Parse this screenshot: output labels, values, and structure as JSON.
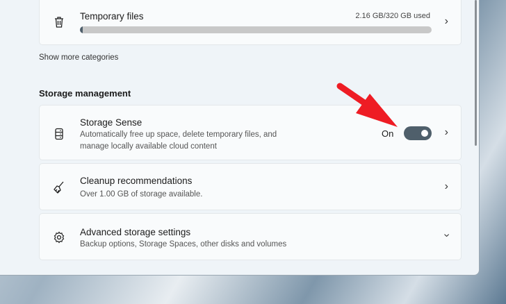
{
  "temp": {
    "title": "Temporary files",
    "usage": "2.16 GB/320 GB used",
    "used_fraction": 0.00675
  },
  "show_more": "Show more categories",
  "section": "Storage management",
  "sense": {
    "title": "Storage Sense",
    "desc1": "Automatically free up space, delete temporary files, and",
    "desc2": "manage locally available cloud content",
    "state": "On"
  },
  "cleanup": {
    "title": "Cleanup recommendations",
    "desc": "Over 1.00 GB of storage available."
  },
  "advanced": {
    "title": "Advanced storage settings",
    "desc": "Backup options, Storage Spaces, other disks and volumes"
  },
  "colors": {
    "arrow": "#ee1c24",
    "toggle": "#4f5f6b"
  }
}
